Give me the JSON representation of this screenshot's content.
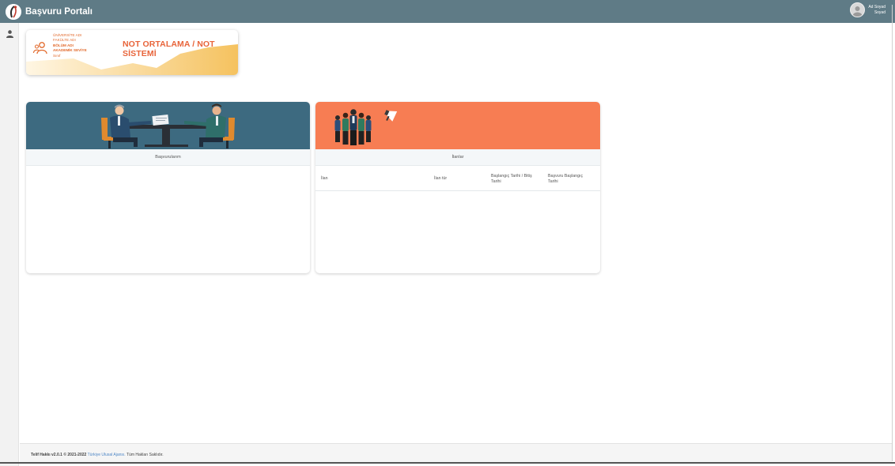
{
  "app": {
    "title": "Başvuru Portalı"
  },
  "user": {
    "name": "Ad Soyad",
    "surname": "Soyad"
  },
  "stats_card": {
    "lines": [
      "ÜNİVERSİTE ADI",
      "FAKÜLTE ADI",
      "BÖLÜM ADI",
      "AKADEMİK SEVİYE",
      "Sınıf"
    ],
    "title": "NOT ORTALAMA / NOT SİSTEMİ"
  },
  "applications": {
    "caption": "Başvurularım"
  },
  "announcements": {
    "caption": "İlanlar",
    "columns": [
      "İlan",
      "İlan tür",
      "Başlangıç Tarihi / Bitiş Tarihi",
      "Başvuru Başlangıç Tarihi"
    ]
  },
  "footer": {
    "version": "Telif Hakkı v2.0.1 © 2021-2022",
    "agency": "Türkiye Ulusal Ajansı.",
    "rights": "Tüm Hakları Saklıdır."
  },
  "colors": {
    "topbar": "#5f7b86",
    "hero_left": "#3d6a80",
    "hero_right": "#f77d53",
    "accent": "#e8643a"
  }
}
